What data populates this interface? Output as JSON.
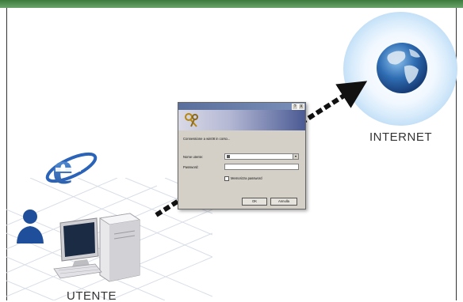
{
  "labels": {
    "internet": "INTERNET",
    "utente": "UTENTE"
  },
  "dialog": {
    "title_buttons": [
      "?",
      "X"
    ],
    "status": "Connessione a win08 in corso...",
    "username_label": "Nome utente:",
    "password_label": "Password:",
    "remember_label": "Memorizza password",
    "ok_label": "OK",
    "cancel_label": "Annulla"
  },
  "icons": {
    "globe": "globe-icon",
    "browser": "internet-explorer-icon",
    "user": "user-icon",
    "computer": "computer-icon",
    "keys": "keys-icon"
  },
  "colors": {
    "arrow": "#111111",
    "globe_ocean": "#2f6db3",
    "ie_blue": "#2a63b8",
    "user_blue": "#1f4f9a",
    "header_green": "#3c7a3c"
  }
}
